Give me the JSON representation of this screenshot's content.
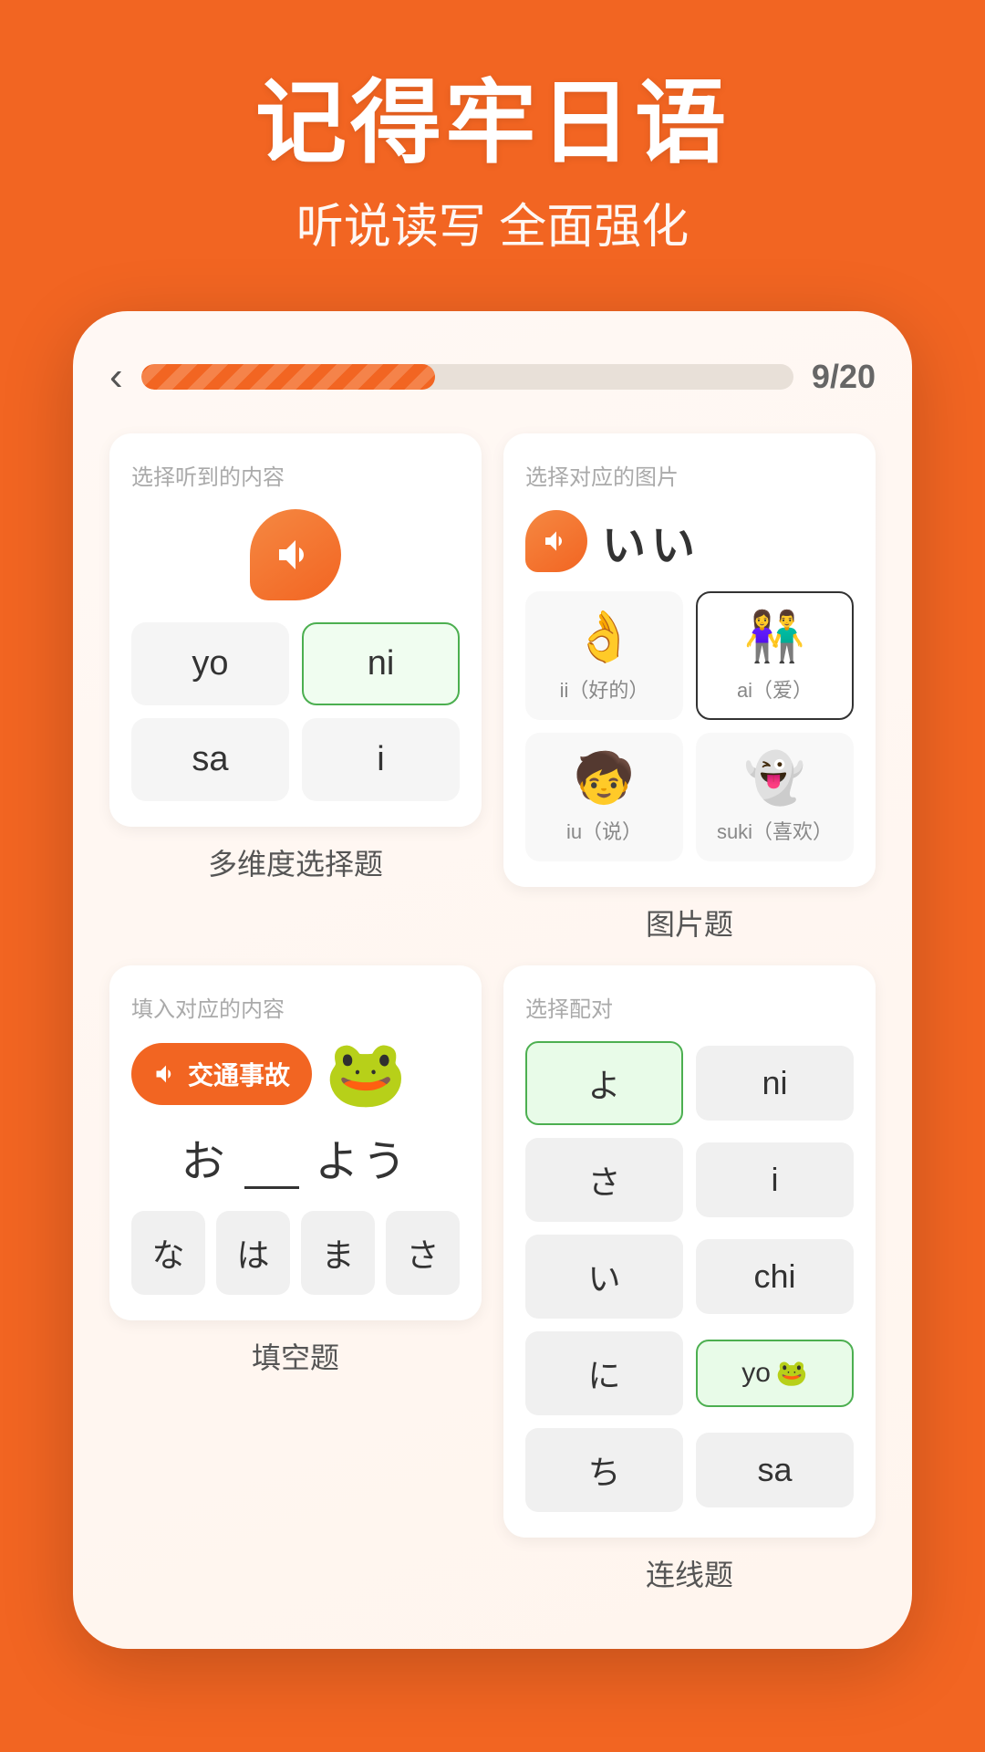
{
  "header": {
    "title": "记得牢日语",
    "subtitle": "听说读写 全面强化"
  },
  "progress": {
    "current": 9,
    "total": 20,
    "label": "9/20",
    "percent": 45
  },
  "back_btn": "‹",
  "card1": {
    "label": "选择听到的内容",
    "type_label": "多维度选择题",
    "choices": [
      "yo",
      "ni",
      "sa",
      "i"
    ],
    "selected": 1
  },
  "card2": {
    "label": "选择对应的图片",
    "type_label": "图片题",
    "kana": "いい",
    "items": [
      {
        "emoji": "👌",
        "label": "ii（好的）"
      },
      {
        "emoji": "👫",
        "label": "ai（爱）"
      },
      {
        "emoji": "🧒",
        "label": "iu（说）"
      },
      {
        "emoji": "👻",
        "label": "suki（喜欢）"
      }
    ],
    "selected": 1
  },
  "card3": {
    "label": "填入对应的内容",
    "type_label": "填空题",
    "audio_text": "交通事故",
    "mascot": "🐸",
    "sentence_before": "お",
    "sentence_after": "よう",
    "options": [
      "な",
      "は",
      "ま",
      "さ"
    ]
  },
  "card4": {
    "label": "选择配对",
    "type_label": "连线题",
    "left": [
      "よ",
      "さ",
      "い",
      "に",
      "ち"
    ],
    "right": [
      "ni",
      "i",
      "chi",
      "yo",
      "sa"
    ],
    "selected_left": 0,
    "selected_right": 3
  }
}
